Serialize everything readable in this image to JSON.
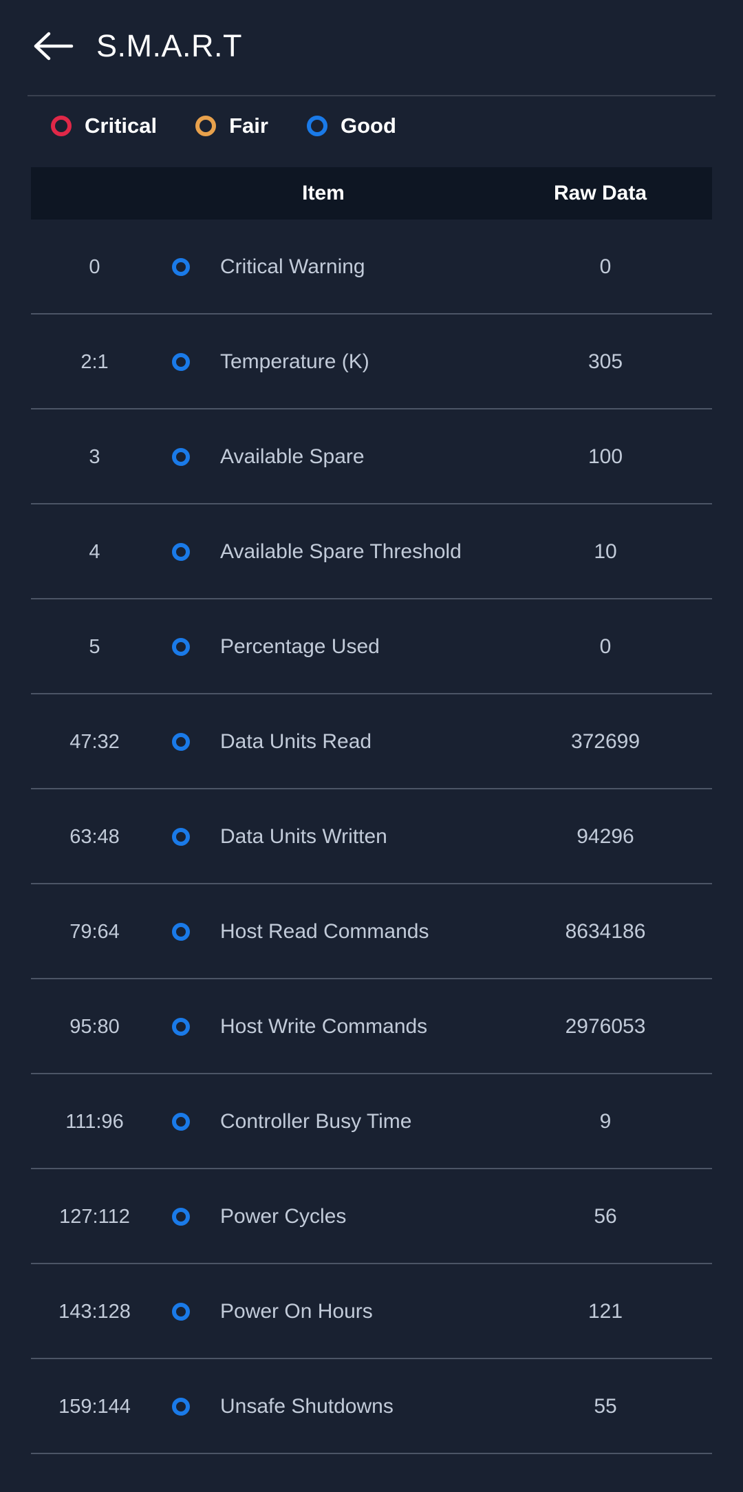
{
  "appbar": {
    "back_icon": "arrow-left-icon",
    "title": "S.M.A.R.T"
  },
  "legend": {
    "items": [
      {
        "label": "Critical",
        "color": "#e02848",
        "icon": "ring-icon"
      },
      {
        "label": "Fair",
        "color": "#e8a14c",
        "icon": "ring-icon"
      },
      {
        "label": "Good",
        "color": "#1a7ae8",
        "icon": "ring-icon"
      }
    ]
  },
  "table": {
    "headers": {
      "id": "",
      "item": "Item",
      "raw": "Raw Data"
    },
    "rows": [
      {
        "id": "0",
        "status": "Good",
        "status_color": "#1a7ae8",
        "item": "Critical Warning",
        "raw": "0"
      },
      {
        "id": "2:1",
        "status": "Good",
        "status_color": "#1a7ae8",
        "item": "Temperature (K)",
        "raw": "305"
      },
      {
        "id": "3",
        "status": "Good",
        "status_color": "#1a7ae8",
        "item": "Available Spare",
        "raw": "100"
      },
      {
        "id": "4",
        "status": "Good",
        "status_color": "#1a7ae8",
        "item": "Available Spare Threshold",
        "raw": "10"
      },
      {
        "id": "5",
        "status": "Good",
        "status_color": "#1a7ae8",
        "item": "Percentage Used",
        "raw": "0"
      },
      {
        "id": "47:32",
        "status": "Good",
        "status_color": "#1a7ae8",
        "item": "Data Units Read",
        "raw": "372699"
      },
      {
        "id": "63:48",
        "status": "Good",
        "status_color": "#1a7ae8",
        "item": "Data Units Written",
        "raw": "94296"
      },
      {
        "id": "79:64",
        "status": "Good",
        "status_color": "#1a7ae8",
        "item": "Host Read Commands",
        "raw": "8634186"
      },
      {
        "id": "95:80",
        "status": "Good",
        "status_color": "#1a7ae8",
        "item": "Host Write Commands",
        "raw": "2976053"
      },
      {
        "id": "111:96",
        "status": "Good",
        "status_color": "#1a7ae8",
        "item": "Controller Busy Time",
        "raw": "9"
      },
      {
        "id": "127:112",
        "status": "Good",
        "status_color": "#1a7ae8",
        "item": "Power Cycles",
        "raw": "56"
      },
      {
        "id": "143:128",
        "status": "Good",
        "status_color": "#1a7ae8",
        "item": "Power On Hours",
        "raw": "121"
      },
      {
        "id": "159:144",
        "status": "Good",
        "status_color": "#1a7ae8",
        "item": "Unsafe Shutdowns",
        "raw": "55"
      }
    ]
  },
  "theme": {
    "background": "#192131",
    "header_background": "#0e1623",
    "divider": "#4c5566",
    "text_primary": "#ffffff",
    "text_secondary": "#c2cbd9"
  }
}
